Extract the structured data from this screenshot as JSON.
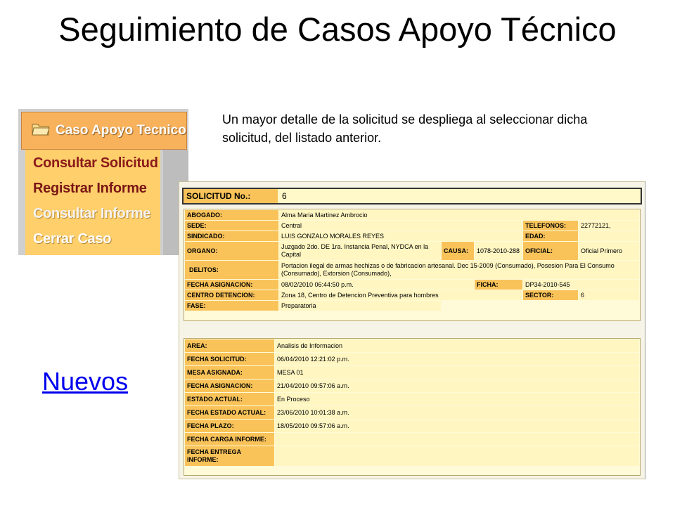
{
  "slide": {
    "title": "Seguimiento de Casos Apoyo Técnico",
    "description": "Un mayor detalle de la solicitud se despliega al seleccionar dicha solicitud, del listado anterior.",
    "link_label": "Nuevos"
  },
  "menu": {
    "title": "Caso Apoyo Tecnico",
    "items": [
      {
        "label": "Consultar Solicitud"
      },
      {
        "label": "Registrar Informe"
      },
      {
        "label": "Consultar Informe"
      },
      {
        "label": "Cerrar Caso"
      }
    ]
  },
  "form": {
    "solicitud_label": "SOLICITUD No.:",
    "solicitud_value": "6",
    "details": {
      "abogado_label": "ABOGADO:",
      "abogado_value": "Alma Maria Martinez Ambrocio",
      "sede_label": "SEDE:",
      "sede_value": "Central",
      "telefonos_label": "TELEFONOS:",
      "telefonos_value": "22772121,",
      "sindicado_label": "SINDICADO:",
      "sindicado_value": "LUIS GONZALO MORALES REYES",
      "edad_label": "EDAD:",
      "edad_value": "",
      "organo_label": "ORGANO:",
      "organo_value": "Juzgado 2do. DE 1ra. Instancia Penal, NYDCA en la Capital",
      "causa_label": "CAUSA:",
      "causa_value": "1078-2010-288",
      "oficial_label": "OFICIAL:",
      "oficial_value": "Oficial Primero",
      "delitos_label": "DELITOS:",
      "delitos_value": "Portacion ilegal de armas hechizas o de fabricacion artesanal. Dec 15-2009 (Consumado), Posesion Para El Consumo (Consumado), Extorsion (Consumado),",
      "fecha_asignacion_label": "FECHA ASIGNACION:",
      "fecha_asignacion_value": "08/02/2010 06:44:50 p.m.",
      "ficha_label": "FICHA:",
      "ficha_value": "DP34-2010-545",
      "centro_label": "CENTRO DETENCION:",
      "centro_value": "Zona 18, Centro de Detencion Preventiva para hombres",
      "sector_label": "SECTOR:",
      "sector_value": "6",
      "fase_label": "FASE:",
      "fase_value": "Preparatoria"
    },
    "tracking": [
      {
        "label": "AREA:",
        "value": "Analisis de Informacion"
      },
      {
        "label": "FECHA SOLICITUD:",
        "value": "06/04/2010 12:21:02 p.m."
      },
      {
        "label": "MESA ASIGNADA:",
        "value": "MESA 01"
      },
      {
        "label": "FECHA ASIGNACION:",
        "value": "21/04/2010 09:57:06 a.m."
      },
      {
        "label": "ESTADO ACTUAL:",
        "value": "En Proceso"
      },
      {
        "label": "FECHA ESTADO ACTUAL:",
        "value": "23/06/2010 10:01:38 a.m."
      },
      {
        "label": "FECHA PLAZO:",
        "value": "18/05/2010 09:57:06 a.m."
      },
      {
        "label": "FECHA CARGA INFORME:",
        "value": ""
      },
      {
        "label": "FECHA ENTREGA INFORME:",
        "value": ""
      }
    ]
  },
  "colors": {
    "label_bg": "#f9c35a",
    "value_bg": "#fff6c2",
    "menu_header": "#f8b25c",
    "menu_list": "#fecf6b",
    "link": "#0000ee"
  }
}
